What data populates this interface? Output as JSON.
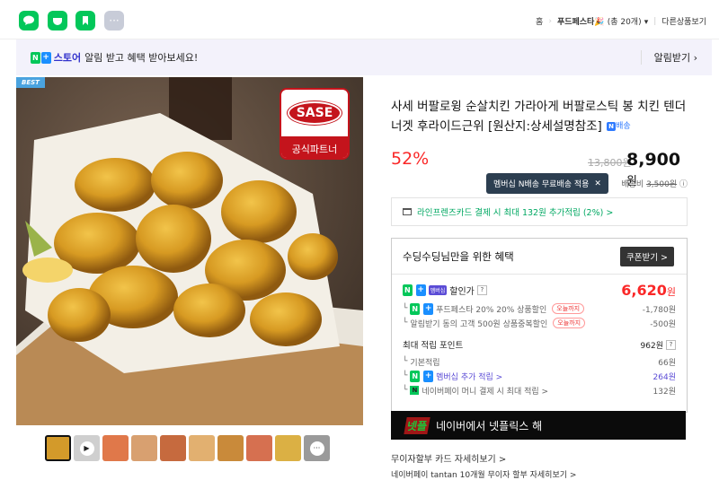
{
  "share": {
    "blog": "blog",
    "cafe": "cafe",
    "keep": "keep",
    "more": "more"
  },
  "nav": {
    "home": "홈",
    "store": "푸드페스타",
    "store_emoji": "🎉",
    "count": "(총 20개)",
    "other": "다른상품보기"
  },
  "banner": {
    "store_label": "스토어",
    "text": "알림 받고 혜택 받아보세요!",
    "alarm_button": "알림받기"
  },
  "photo": {
    "best_badge": "BEST",
    "partner_logo": "SASE",
    "partner_label": "공식파트너"
  },
  "thumbnails": [
    "t1",
    "t2",
    "t3",
    "t4",
    "t5",
    "t6",
    "t7",
    "t8",
    "t9",
    "more"
  ],
  "product": {
    "title": "사세 버팔로윙 순살치킨 가라아게 버팔로스틱 봉 치킨 텐더 너겟 후라이드근위 [원산지:상세설명참조]",
    "delivery_tag": "배송",
    "discount": "52%",
    "original_price": "13,800원",
    "price": "8,900",
    "price_unit": "원",
    "tooltip": "멤버십 N배송 무료배송 적용",
    "shipping_label": "배송비",
    "shipping_fee": "3,500원"
  },
  "card_bar": {
    "text": "라인프렌즈카드 결제 시 최대 132원 추가적립 (2%) >"
  },
  "benefit": {
    "heading": "수딩수딩님만을 위한 혜택",
    "coupon_button": "쿠폰받기 >",
    "sale_label": "할인가",
    "sale_price": "6,620",
    "sale_unit": "원",
    "d1_text": "푸드페스타 20% 20% 상품할인",
    "d1_badge": "오늘까지",
    "d1_value": "-1,780원",
    "d2_text": "알림받기 동의 고객 500원 상품중복할인",
    "d2_badge": "오늘까지",
    "d2_value": "-500원",
    "points_label": "최대 적립 포인트",
    "points_value": "962원",
    "p1_text": "기본적립",
    "p1_value": "66원",
    "p2_text": "멤버십 추가 적립 >",
    "p2_value": "264원",
    "p3_text": "네이버페이 머니 결제 시 최대 적립 >",
    "p3_value": "132원"
  },
  "netflix": {
    "logo": "넷플",
    "text": "네이버에서 넷플릭스 해"
  },
  "bottom": {
    "line1": "무이자할부   카드 자세히보기 >",
    "line2": "네이버페이 tantan 10개월 무이자 할부   자세히보기 >"
  }
}
